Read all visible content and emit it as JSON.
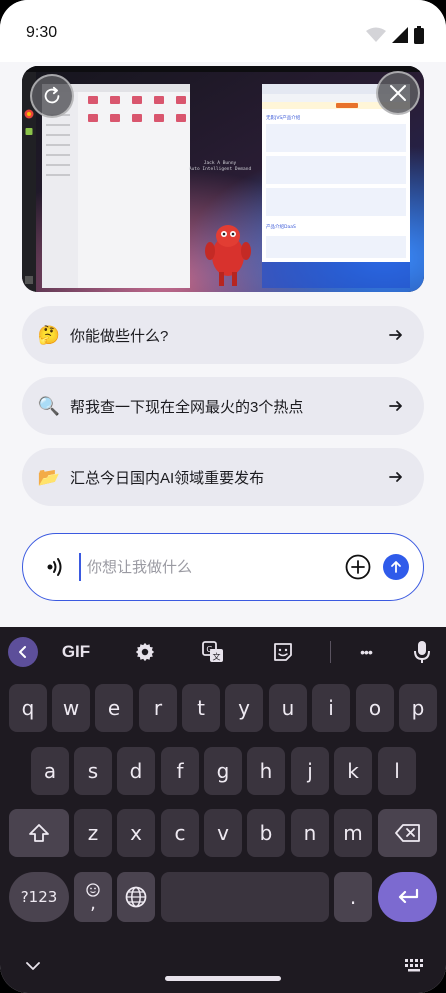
{
  "status_bar": {
    "time": "9:30"
  },
  "preview": {
    "desktop_title": "Jack A Bunny\nAuto Intelligent Demand",
    "browser_header": "无影JVS产品介绍",
    "browser_section": "产品介绍DaaS",
    "browser_notice": "Google Chrome isn't your default browser",
    "browser_notice_button": "Set as default"
  },
  "suggestions": [
    {
      "emoji": "🤔",
      "text": "你能做些什么?"
    },
    {
      "emoji": "🔍",
      "text": "帮我查一下现在全网最火的3个热点"
    },
    {
      "emoji": "📂",
      "text": "汇总今日国内AI领域重要发布"
    }
  ],
  "input": {
    "placeholder": "你想让我做什么",
    "value": ""
  },
  "keyboard": {
    "toolbar": {
      "gif": "GIF",
      "more": "•••"
    },
    "row1": [
      "q",
      "w",
      "e",
      "r",
      "t",
      "y",
      "u",
      "i",
      "o",
      "p"
    ],
    "row2": [
      "a",
      "s",
      "d",
      "f",
      "g",
      "h",
      "j",
      "k",
      "l"
    ],
    "row3": [
      "z",
      "x",
      "c",
      "v",
      "b",
      "n",
      "m"
    ],
    "symbols": "?123",
    "comma": ",",
    "period": "."
  },
  "colors": {
    "accent": "#3b5ae0",
    "keyboard_bg": "#1e1a21",
    "key_bg": "#3a343e",
    "enter_key": "#7c6ad0"
  }
}
